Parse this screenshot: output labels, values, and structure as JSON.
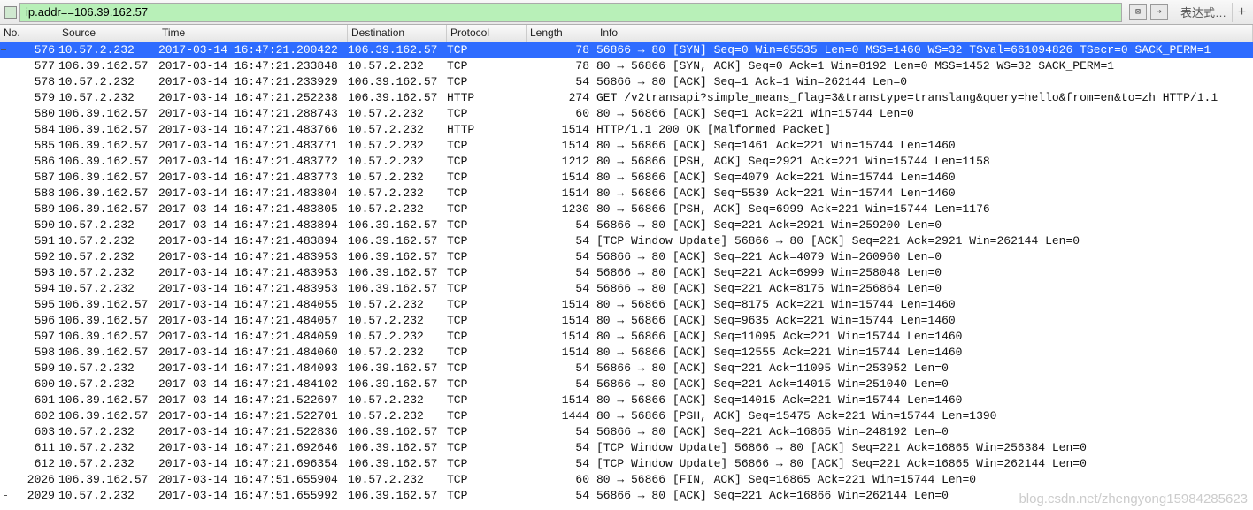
{
  "toolbar": {
    "filter_value": "ip.addr==106.39.162.57",
    "expr_label": "表达式…",
    "clear_glyph": "⊠",
    "apply_glyph": "➔",
    "plus_glyph": "+"
  },
  "headers": {
    "no": "No.",
    "source": "Source",
    "time": "Time",
    "destination": "Destination",
    "protocol": "Protocol",
    "length": "Length",
    "info": "Info"
  },
  "rows": [
    {
      "no": "576",
      "src": "10.57.2.232",
      "time": "2017-03-14 16:47:21.200422",
      "dst": "106.39.162.57",
      "proto": "TCP",
      "len": "78",
      "info": "56866 → 80 [SYN] Seq=0 Win=65535 Len=0 MSS=1460 WS=32 TSval=661094826 TSecr=0 SACK_PERM=1",
      "sel": true,
      "tree": "start"
    },
    {
      "no": "577",
      "src": "106.39.162.57",
      "time": "2017-03-14 16:47:21.233848",
      "dst": "10.57.2.232",
      "proto": "TCP",
      "len": "78",
      "info": "80 → 56866 [SYN, ACK] Seq=0 Ack=1 Win=8192 Len=0 MSS=1452 WS=32 SACK_PERM=1",
      "tree": "line"
    },
    {
      "no": "578",
      "src": "10.57.2.232",
      "time": "2017-03-14 16:47:21.233929",
      "dst": "106.39.162.57",
      "proto": "TCP",
      "len": "54",
      "info": "56866 → 80 [ACK] Seq=1 Ack=1 Win=262144 Len=0",
      "tree": "line"
    },
    {
      "no": "579",
      "src": "10.57.2.232",
      "time": "2017-03-14 16:47:21.252238",
      "dst": "106.39.162.57",
      "proto": "HTTP",
      "len": "274",
      "info": "GET /v2transapi?simple_means_flag=3&transtype=translang&query=hello&from=en&to=zh HTTP/1.1",
      "tree": "line"
    },
    {
      "no": "580",
      "src": "106.39.162.57",
      "time": "2017-03-14 16:47:21.288743",
      "dst": "10.57.2.232",
      "proto": "TCP",
      "len": "60",
      "info": "80 → 56866 [ACK] Seq=1 Ack=221 Win=15744 Len=0",
      "tree": "line"
    },
    {
      "no": "584",
      "src": "106.39.162.57",
      "time": "2017-03-14 16:47:21.483766",
      "dst": "10.57.2.232",
      "proto": "HTTP",
      "len": "1514",
      "info": "HTTP/1.1 200 OK [Malformed Packet]",
      "tree": "line"
    },
    {
      "no": "585",
      "src": "106.39.162.57",
      "time": "2017-03-14 16:47:21.483771",
      "dst": "10.57.2.232",
      "proto": "TCP",
      "len": "1514",
      "info": "80 → 56866 [ACK] Seq=1461 Ack=221 Win=15744 Len=1460",
      "tree": "line"
    },
    {
      "no": "586",
      "src": "106.39.162.57",
      "time": "2017-03-14 16:47:21.483772",
      "dst": "10.57.2.232",
      "proto": "TCP",
      "len": "1212",
      "info": "80 → 56866 [PSH, ACK] Seq=2921 Ack=221 Win=15744 Len=1158",
      "tree": "line"
    },
    {
      "no": "587",
      "src": "106.39.162.57",
      "time": "2017-03-14 16:47:21.483773",
      "dst": "10.57.2.232",
      "proto": "TCP",
      "len": "1514",
      "info": "80 → 56866 [ACK] Seq=4079 Ack=221 Win=15744 Len=1460",
      "tree": "line"
    },
    {
      "no": "588",
      "src": "106.39.162.57",
      "time": "2017-03-14 16:47:21.483804",
      "dst": "10.57.2.232",
      "proto": "TCP",
      "len": "1514",
      "info": "80 → 56866 [ACK] Seq=5539 Ack=221 Win=15744 Len=1460",
      "tree": "line"
    },
    {
      "no": "589",
      "src": "106.39.162.57",
      "time": "2017-03-14 16:47:21.483805",
      "dst": "10.57.2.232",
      "proto": "TCP",
      "len": "1230",
      "info": "80 → 56866 [PSH, ACK] Seq=6999 Ack=221 Win=15744 Len=1176",
      "tree": "line"
    },
    {
      "no": "590",
      "src": "10.57.2.232",
      "time": "2017-03-14 16:47:21.483894",
      "dst": "106.39.162.57",
      "proto": "TCP",
      "len": "54",
      "info": "56866 → 80 [ACK] Seq=221 Ack=2921 Win=259200 Len=0",
      "tree": "line"
    },
    {
      "no": "591",
      "src": "10.57.2.232",
      "time": "2017-03-14 16:47:21.483894",
      "dst": "106.39.162.57",
      "proto": "TCP",
      "len": "54",
      "info": "[TCP Window Update] 56866 → 80 [ACK] Seq=221 Ack=2921 Win=262144 Len=0",
      "tree": "line"
    },
    {
      "no": "592",
      "src": "10.57.2.232",
      "time": "2017-03-14 16:47:21.483953",
      "dst": "106.39.162.57",
      "proto": "TCP",
      "len": "54",
      "info": "56866 → 80 [ACK] Seq=221 Ack=4079 Win=260960 Len=0",
      "tree": "line"
    },
    {
      "no": "593",
      "src": "10.57.2.232",
      "time": "2017-03-14 16:47:21.483953",
      "dst": "106.39.162.57",
      "proto": "TCP",
      "len": "54",
      "info": "56866 → 80 [ACK] Seq=221 Ack=6999 Win=258048 Len=0",
      "tree": "line"
    },
    {
      "no": "594",
      "src": "10.57.2.232",
      "time": "2017-03-14 16:47:21.483953",
      "dst": "106.39.162.57",
      "proto": "TCP",
      "len": "54",
      "info": "56866 → 80 [ACK] Seq=221 Ack=8175 Win=256864 Len=0",
      "tree": "line"
    },
    {
      "no": "595",
      "src": "106.39.162.57",
      "time": "2017-03-14 16:47:21.484055",
      "dst": "10.57.2.232",
      "proto": "TCP",
      "len": "1514",
      "info": "80 → 56866 [ACK] Seq=8175 Ack=221 Win=15744 Len=1460",
      "tree": "line"
    },
    {
      "no": "596",
      "src": "106.39.162.57",
      "time": "2017-03-14 16:47:21.484057",
      "dst": "10.57.2.232",
      "proto": "TCP",
      "len": "1514",
      "info": "80 → 56866 [ACK] Seq=9635 Ack=221 Win=15744 Len=1460",
      "tree": "line"
    },
    {
      "no": "597",
      "src": "106.39.162.57",
      "time": "2017-03-14 16:47:21.484059",
      "dst": "10.57.2.232",
      "proto": "TCP",
      "len": "1514",
      "info": "80 → 56866 [ACK] Seq=11095 Ack=221 Win=15744 Len=1460",
      "tree": "line"
    },
    {
      "no": "598",
      "src": "106.39.162.57",
      "time": "2017-03-14 16:47:21.484060",
      "dst": "10.57.2.232",
      "proto": "TCP",
      "len": "1514",
      "info": "80 → 56866 [ACK] Seq=12555 Ack=221 Win=15744 Len=1460",
      "tree": "line"
    },
    {
      "no": "599",
      "src": "10.57.2.232",
      "time": "2017-03-14 16:47:21.484093",
      "dst": "106.39.162.57",
      "proto": "TCP",
      "len": "54",
      "info": "56866 → 80 [ACK] Seq=221 Ack=11095 Win=253952 Len=0",
      "tree": "line"
    },
    {
      "no": "600",
      "src": "10.57.2.232",
      "time": "2017-03-14 16:47:21.484102",
      "dst": "106.39.162.57",
      "proto": "TCP",
      "len": "54",
      "info": "56866 → 80 [ACK] Seq=221 Ack=14015 Win=251040 Len=0",
      "tree": "line"
    },
    {
      "no": "601",
      "src": "106.39.162.57",
      "time": "2017-03-14 16:47:21.522697",
      "dst": "10.57.2.232",
      "proto": "TCP",
      "len": "1514",
      "info": "80 → 56866 [ACK] Seq=14015 Ack=221 Win=15744 Len=1460",
      "tree": "line"
    },
    {
      "no": "602",
      "src": "106.39.162.57",
      "time": "2017-03-14 16:47:21.522701",
      "dst": "10.57.2.232",
      "proto": "TCP",
      "len": "1444",
      "info": "80 → 56866 [PSH, ACK] Seq=15475 Ack=221 Win=15744 Len=1390",
      "tree": "line"
    },
    {
      "no": "603",
      "src": "10.57.2.232",
      "time": "2017-03-14 16:47:21.522836",
      "dst": "106.39.162.57",
      "proto": "TCP",
      "len": "54",
      "info": "56866 → 80 [ACK] Seq=221 Ack=16865 Win=248192 Len=0",
      "tree": "line"
    },
    {
      "no": "611",
      "src": "10.57.2.232",
      "time": "2017-03-14 16:47:21.692646",
      "dst": "106.39.162.57",
      "proto": "TCP",
      "len": "54",
      "info": "[TCP Window Update] 56866 → 80 [ACK] Seq=221 Ack=16865 Win=256384 Len=0",
      "tree": "line"
    },
    {
      "no": "612",
      "src": "10.57.2.232",
      "time": "2017-03-14 16:47:21.696354",
      "dst": "106.39.162.57",
      "proto": "TCP",
      "len": "54",
      "info": "[TCP Window Update] 56866 → 80 [ACK] Seq=221 Ack=16865 Win=262144 Len=0",
      "tree": "line"
    },
    {
      "no": "2026",
      "src": "106.39.162.57",
      "time": "2017-03-14 16:47:51.655904",
      "dst": "10.57.2.232",
      "proto": "TCP",
      "len": "60",
      "info": "80 → 56866 [FIN, ACK] Seq=16865 Ack=221 Win=15744 Len=0",
      "tree": "line"
    },
    {
      "no": "2029",
      "src": "10.57.2.232",
      "time": "2017-03-14 16:47:51.655992",
      "dst": "106.39.162.57",
      "proto": "TCP",
      "len": "54",
      "info": "56866 → 80 [ACK] Seq=221 Ack=16866 Win=262144 Len=0",
      "tree": "end"
    }
  ],
  "watermark": "blog.csdn.net/zhengyong15984285623"
}
